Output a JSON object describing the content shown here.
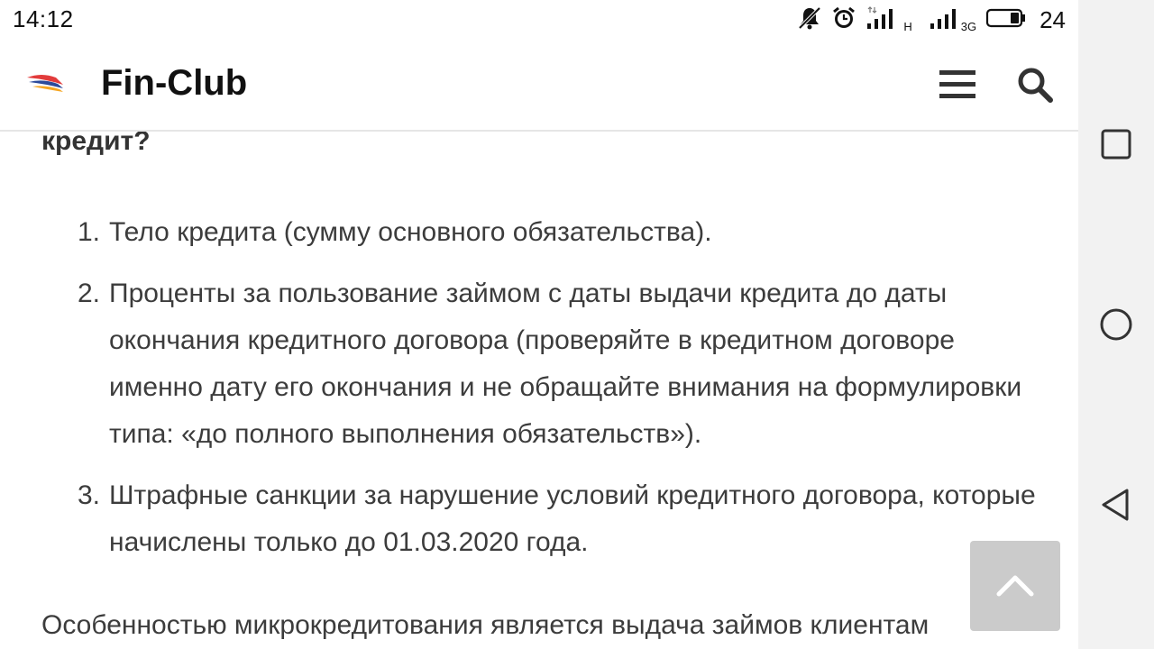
{
  "status_bar": {
    "time": "14:12",
    "network_1_label": "H",
    "network_2_label": "3G",
    "battery_level": "24",
    "icons": [
      "muted-bell-icon",
      "alarm-clock-icon",
      "signal-strength-icon",
      "signal-strength-icon",
      "battery-icon"
    ]
  },
  "header": {
    "logo_icon": "fin-club-logo",
    "title": "Fin-Club",
    "menu_icon": "hamburger-menu-icon",
    "search_icon": "search-icon"
  },
  "article": {
    "heading_tail": "кредит?",
    "list": [
      {
        "number": "1.",
        "text": "Тело кредита (сумму основного обязательства)."
      },
      {
        "number": "2.",
        "text": "Проценты за пользование займом с даты выдачи кредита до даты окончания кредитного договора (проверяйте в кредитном договоре именно дату его окончания и не обращайте внимания на формулировки типа: «до полного выполнения обязательств»)."
      },
      {
        "number": "3.",
        "text": "Штрафные санкции за нарушение условий кредитного договора, которые начислены только до 01.03.2020 года."
      }
    ],
    "paragraph_start": "Особенностью микрокредитования является выдача займов клиентам"
  },
  "scroll_top": {
    "icon": "chevron-up-icon"
  },
  "system_nav": {
    "recents_icon": "square-recents-icon",
    "home_icon": "circle-home-icon",
    "back_icon": "triangle-back-icon"
  },
  "colors": {
    "text": "#3c3c3c",
    "title": "#111111",
    "logo_red": "#e23b3b",
    "logo_blue": "#2b4a9a",
    "logo_orange": "#f5a623"
  }
}
